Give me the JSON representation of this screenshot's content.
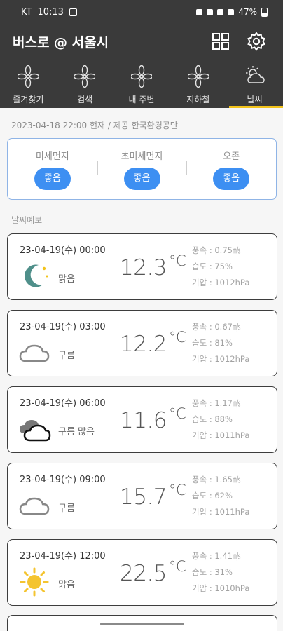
{
  "status_bar": {
    "carrier": "KT",
    "time": "10:13",
    "battery": "47%"
  },
  "app_bar": {
    "title": "버스로 @ 서울시",
    "icons": [
      "grid-icon",
      "gear-icon"
    ]
  },
  "tabs": [
    {
      "label": "즐겨찾기",
      "icon": "fan-icon"
    },
    {
      "label": "검색",
      "icon": "fan-icon"
    },
    {
      "label": "내 주변",
      "icon": "fan-icon"
    },
    {
      "label": "지하철",
      "icon": "fan-icon"
    },
    {
      "label": "날씨",
      "icon": "weather-icon",
      "active": true
    }
  ],
  "updated": "2023-04-18 22:00 현재 / 제공 한국환경공단",
  "air_quality": [
    {
      "name": "미세먼지",
      "status": "좋음"
    },
    {
      "name": "초미세먼지",
      "status": "좋음"
    },
    {
      "name": "오존",
      "status": "좋음"
    }
  ],
  "forecast_label": "날씨예보",
  "forecast": [
    {
      "datetime": "23-04-19(수) 00:00",
      "condition": "맑음",
      "icon": "moon-icon",
      "temp": "12.3",
      "unit": "°C",
      "wind": "풍속 : 0.75㎧",
      "humidity": "습도 : 75%",
      "pressure": "기압 : 1012hPa"
    },
    {
      "datetime": "23-04-19(수) 03:00",
      "condition": "구름",
      "icon": "cloud-icon",
      "temp": "12.2",
      "unit": "°C",
      "wind": "풍속 : 0.67㎧",
      "humidity": "습도 : 81%",
      "pressure": "기압 : 1012hPa"
    },
    {
      "datetime": "23-04-19(수) 06:00",
      "condition": "구름 많음",
      "icon": "clouds-icon",
      "temp": "11.6",
      "unit": "°C",
      "wind": "풍속 : 1.17㎧",
      "humidity": "습도 : 88%",
      "pressure": "기압 : 1011hPa"
    },
    {
      "datetime": "23-04-19(수) 09:00",
      "condition": "구름",
      "icon": "cloud-icon",
      "temp": "15.7",
      "unit": "°C",
      "wind": "풍속 : 1.65㎧",
      "humidity": "습도 : 62%",
      "pressure": "기압 : 1011hPa"
    },
    {
      "datetime": "23-04-19(수) 12:00",
      "condition": "맑음",
      "icon": "sun-icon",
      "temp": "22.5",
      "unit": "°C",
      "wind": "풍속 : 1.41㎧",
      "humidity": "습도 : 31%",
      "pressure": "기압 : 1010hPa"
    }
  ],
  "colors": {
    "bar": "#3a3a3a",
    "accent": "#f2c31b",
    "pill": "#3d8ff2",
    "card_border": "#8fb4e6"
  }
}
